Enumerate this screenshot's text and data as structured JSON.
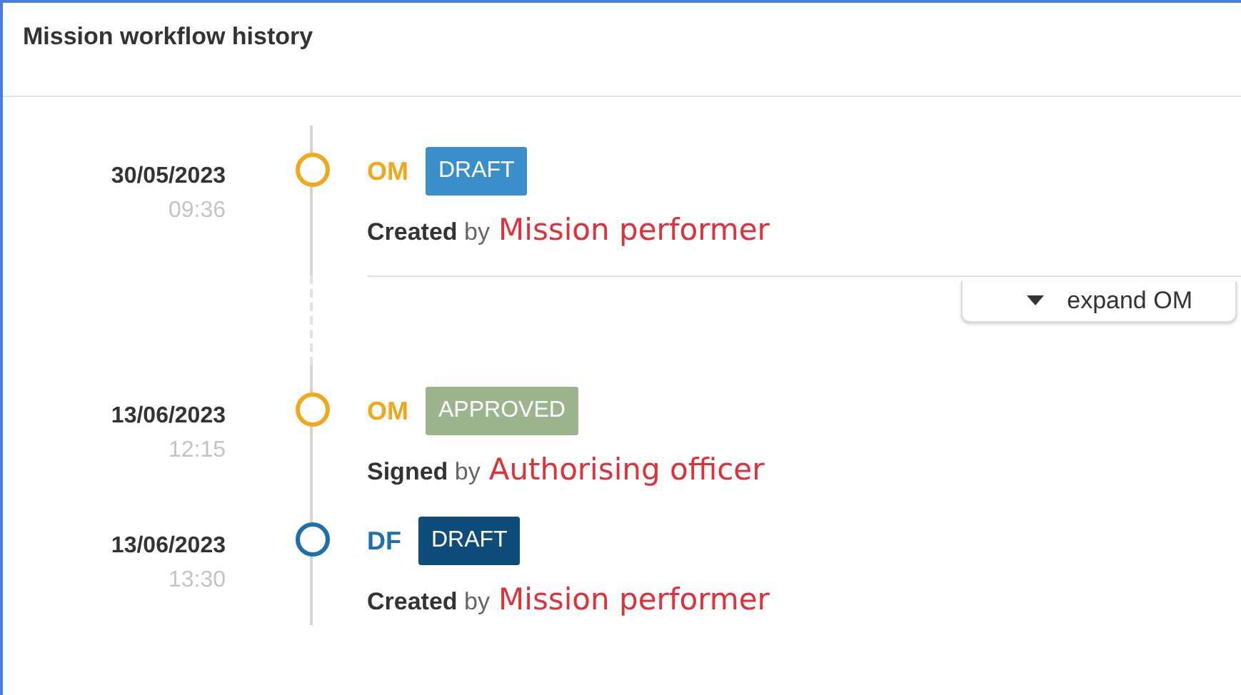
{
  "panel": {
    "title": "Mission workflow history"
  },
  "items": [
    {
      "kind": "event",
      "date": "30/05/2023",
      "time": "09:36",
      "code": "OM",
      "color": "#f0a81c",
      "status": {
        "label": "DRAFT",
        "color": "#3a8fcb"
      },
      "action": "Created",
      "by": "by",
      "person": "Mission performer"
    },
    {
      "kind": "expand",
      "label": "expand OM"
    },
    {
      "kind": "event",
      "date": "13/06/2023",
      "time": "12:15",
      "code": "OM",
      "color": "#f0a81c",
      "status": {
        "label": "APPROVED",
        "color": "#9db58e"
      },
      "action": "Signed",
      "by": "by",
      "person": "Authorising officer"
    },
    {
      "kind": "event",
      "date": "13/06/2023",
      "time": "13:30",
      "code": "DF",
      "color": "#1e6fae",
      "status": {
        "label": "DRAFT",
        "color": "#0f4c7a"
      },
      "action": "Created",
      "by": "by",
      "person": "Mission performer"
    }
  ]
}
